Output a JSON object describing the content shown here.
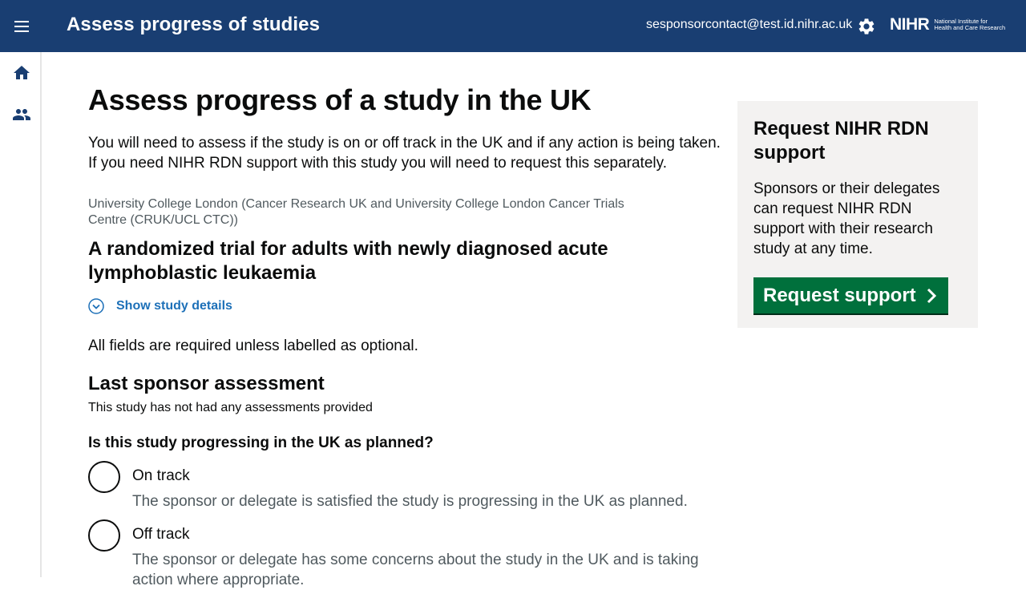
{
  "header": {
    "app_title": "Assess progress of studies",
    "user_email": "sesponsorcontact@test.id.nihr.ac.uk",
    "logo_mark": "NIHR",
    "logo_line1": "National Institute for",
    "logo_line2": "Health and Care Research",
    "background_color": "#193e72"
  },
  "sidenav": {
    "items": [
      {
        "icon": "home-icon"
      },
      {
        "icon": "users-icon"
      }
    ]
  },
  "main": {
    "page_title": "Assess progress of a study in the UK",
    "intro": "You will need to assess if the study is on or off track in the UK and if any action is being taken. If you need NIHR RDN support with this study you will need to request this separately.",
    "organisation": "University College London (Cancer Research UK and University College London Cancer Trials Centre (CRUK/UCL CTC))",
    "study_title": "A randomized trial for adults with newly diagnosed acute lymphoblastic leukaemia",
    "show_details_label": "Show study details",
    "required_note": "All fields are required unless labelled as optional.",
    "last_assessment_heading": "Last sponsor assessment",
    "no_assessments": "This study has not had any assessments provided",
    "question": "Is this study progressing in the UK as planned?",
    "options": [
      {
        "label": "On track",
        "hint": "The sponsor or delegate is satisfied the study is progressing in the UK as planned."
      },
      {
        "label": "Off track",
        "hint": "The sponsor or delegate has some concerns about the study in the UK and is taking action where appropriate."
      }
    ]
  },
  "sidebar": {
    "heading": "Request NIHR RDN support",
    "body": "Sponsors or their delegates can request NIHR RDN support with their research study at any time.",
    "button_label": "Request support",
    "button_color": "#00703c"
  },
  "colors": {
    "link": "#1d70b8",
    "panel_bg": "#f3f2f1"
  }
}
